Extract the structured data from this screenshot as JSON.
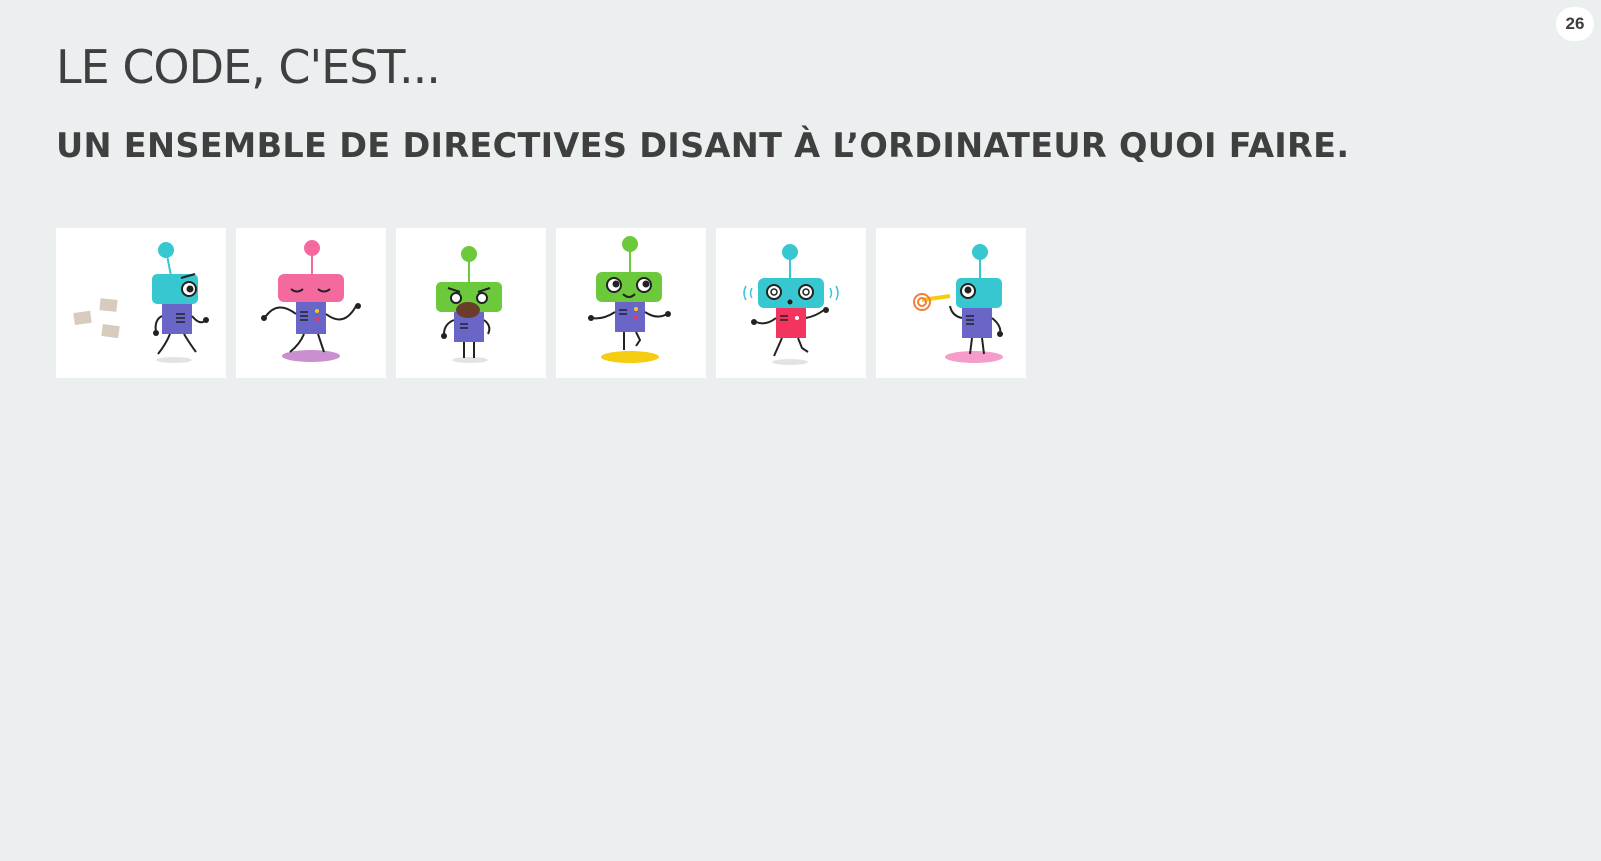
{
  "slide": {
    "page_number": "26",
    "title": "LE CODE, C'EST...",
    "subtitle": "UN ENSEMBLE DE DIRECTIVES DISANT À L’ORDINATEUR QUOI FAIRE."
  },
  "robots": [
    {
      "name": "robot-walking-papers",
      "head_color": "#37c7d0",
      "body_color": "#6a66c8",
      "shadow_color": "#e3e3e3"
    },
    {
      "name": "robot-dancing",
      "head_color": "#f56a9e",
      "body_color": "#6a66c8",
      "shadow_color": "#c98fcf"
    },
    {
      "name": "robot-eating",
      "head_color": "#6cc93b",
      "body_color": "#6a66c8",
      "shadow_color": "#e3e3e3"
    },
    {
      "name": "robot-happy",
      "head_color": "#6cc93b",
      "body_color": "#6a66c8",
      "shadow_color": "#f4cc12"
    },
    {
      "name": "robot-dizzy",
      "head_color": "#37c7d0",
      "body_color": "#f2345e",
      "shadow_color": "#e3e3e3"
    },
    {
      "name": "robot-party",
      "head_color": "#37c7d0",
      "body_color": "#6a66c8",
      "shadow_color": "#f59ccb"
    }
  ],
  "colors": {
    "background": "#ebeff0",
    "text": "#3f3f3f",
    "card": "#ffffff"
  }
}
